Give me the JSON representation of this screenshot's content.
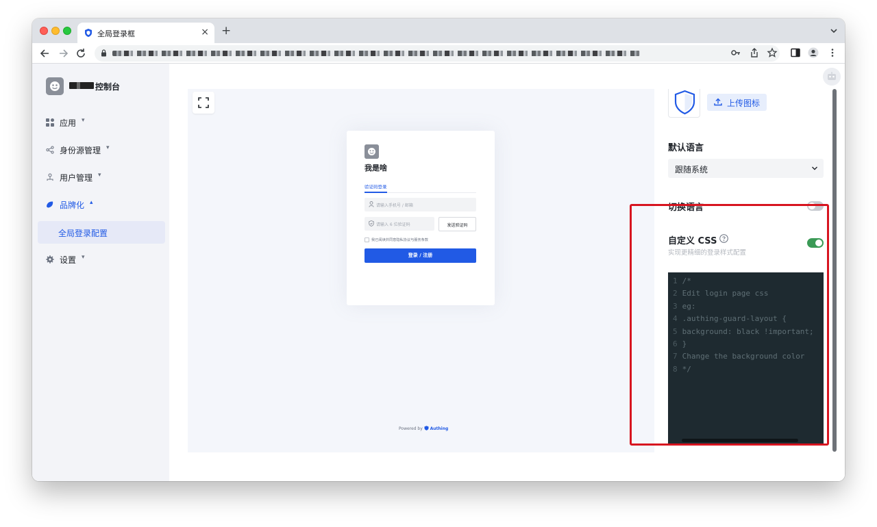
{
  "browser": {
    "tab_title": "全局登录框",
    "new_tab": "+",
    "close_tab": "×"
  },
  "sidebar": {
    "brand_suffix": "控制台",
    "items": [
      {
        "label": "应用",
        "icon": "grid-icon"
      },
      {
        "label": "身份源管理",
        "icon": "share-icon"
      },
      {
        "label": "用户管理",
        "icon": "users-icon"
      },
      {
        "label": "品牌化",
        "icon": "brand-icon"
      },
      {
        "label": "设置",
        "icon": "gear-icon"
      }
    ],
    "sub_item": "全局登录配置",
    "caret_down": "▾",
    "caret_up": "▴"
  },
  "preview": {
    "login": {
      "title": "我是啥",
      "tab": "验证码登录",
      "phone_placeholder": "请输入手机号 / 邮箱",
      "code_placeholder": "请输入 6 位验证码",
      "send_code": "发送验证码",
      "agreement": "我已阅读并同意隐私协议与服务条款",
      "submit": "登录 / 注册"
    },
    "powered_by": "Powered by",
    "powered_brand": "Authing"
  },
  "settings": {
    "upload_button": "上传图标",
    "default_language_label": "默认语言",
    "default_language_value": "跟随系统",
    "switch_language_label": "切换语言",
    "switch_language_enabled": false,
    "custom_css_label": "自定义 CSS",
    "custom_css_enabled": true,
    "custom_css_subtitle": "实现更精细的登录样式配置",
    "code_lines": [
      {
        "n": "1",
        "text": "/*"
      },
      {
        "n": "2",
        "text": "Edit login page css"
      },
      {
        "n": "3",
        "text": "eg:"
      },
      {
        "n": "4",
        "text": ".authing-guard-layout {"
      },
      {
        "n": "5",
        "text": "background: black !important;"
      },
      {
        "n": "6",
        "text": "}"
      },
      {
        "n": "7",
        "text": "Change the background color"
      },
      {
        "n": "8",
        "text": "*/"
      }
    ]
  },
  "colors": {
    "accent": "#215ae5",
    "toggle_on": "#3b9a56",
    "highlight": "#d7141f",
    "editor_bg": "#1e2a30"
  }
}
